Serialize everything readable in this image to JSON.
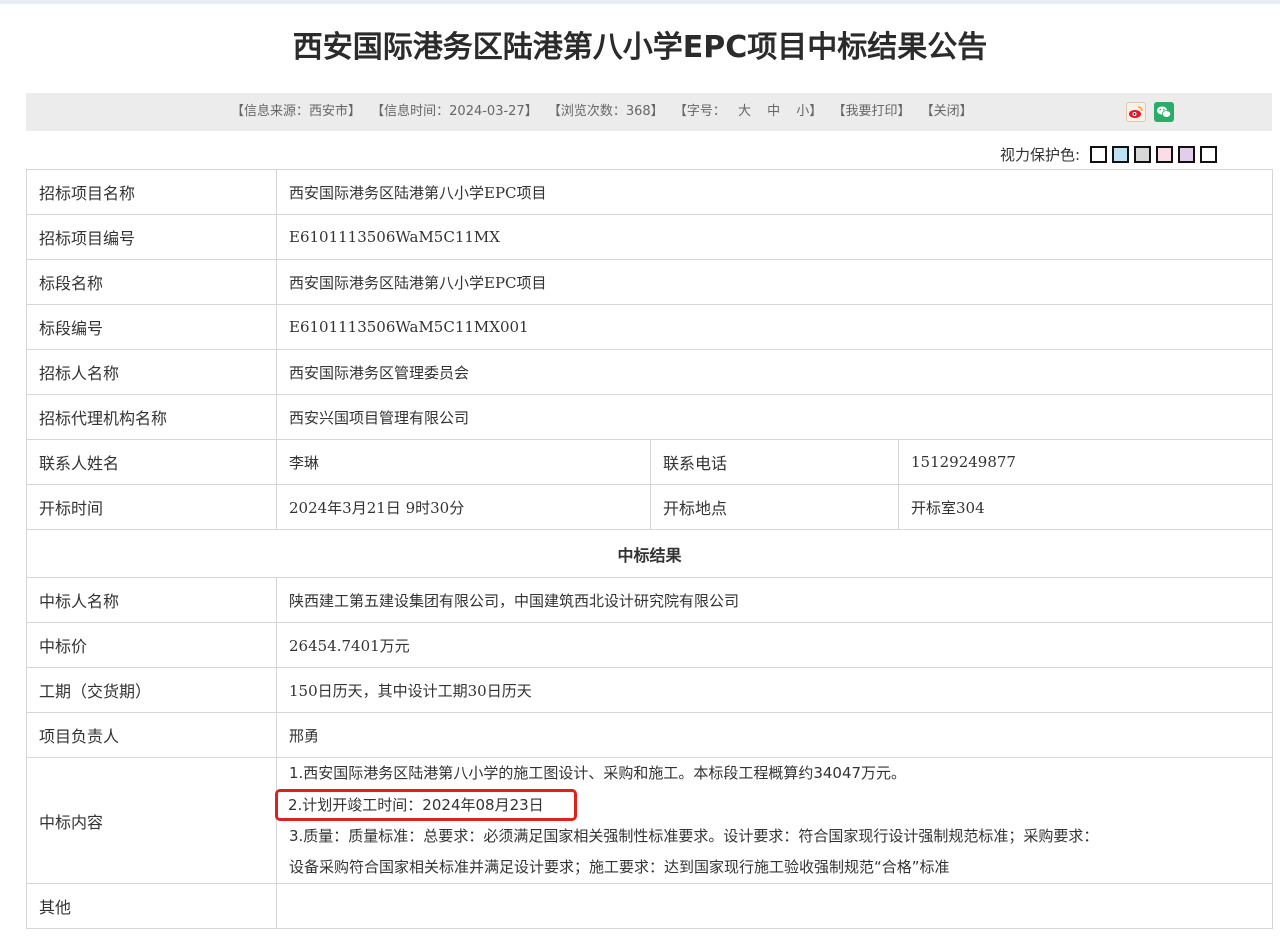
{
  "page": {
    "title": "西安国际港务区陆港第八小学EPC项目中标结果公告"
  },
  "info_bar": {
    "source": "【信息来源：西安市】",
    "time": "【信息时间：2024-03-27】",
    "views": "【浏览次数：368】",
    "font_size_label": "【字号：",
    "font_large": "大",
    "font_medium": "中",
    "font_small": "小】",
    "print": "【我要打印】",
    "close": "【关闭】"
  },
  "share": {
    "weibo_icon": "weibo-icon",
    "wechat_icon": "wechat-icon"
  },
  "eye_protection": {
    "label": "视力保护色:",
    "swatches": [
      "#ffffff",
      "#bde2f3",
      "#d8d8d8",
      "#fadde7",
      "#e3cdef",
      "#ffffff"
    ]
  },
  "table": {
    "rows": [
      {
        "label": "招标项目名称",
        "value": "西安国际港务区陆港第八小学EPC项目"
      },
      {
        "label": "招标项目编号",
        "value": "E6101113506WaM5C11MX"
      },
      {
        "label": "标段名称",
        "value": "西安国际港务区陆港第八小学EPC项目"
      },
      {
        "label": "标段编号",
        "value": "E6101113506WaM5C11MX001"
      },
      {
        "label": "招标人名称",
        "value": "西安国际港务区管理委员会"
      },
      {
        "label": "招标代理机构名称",
        "value": "西安兴国项目管理有限公司"
      }
    ],
    "contact": {
      "label": "联系人姓名",
      "value": "李琳",
      "phone_label": "联系电话",
      "phone_value": "15129249877"
    },
    "opening": {
      "label": "开标时间",
      "value": "2024年3月21日 9时30分",
      "place_label": "开标地点",
      "place_value": "开标室304"
    },
    "section_title": "中标结果",
    "winner": {
      "label": "中标人名称",
      "value": "陕西建工第五建设集团有限公司，中国建筑西北设计研究院有限公司"
    },
    "price": {
      "label": "中标价",
      "value": "26454.7401万元"
    },
    "period": {
      "label": "工期（交货期）",
      "value": "150日历天，其中设计工期30日历天"
    },
    "manager": {
      "label": "项目负责人",
      "value": "邢勇"
    },
    "content": {
      "label": "中标内容",
      "line1": "1.西安国际港务区陆港第八小学的施工图设计、采购和施工。本标段工程概算约34047万元。",
      "line2": "2.计划开竣工时间：2024年08月23日",
      "line3": "3.质量：质量标准：总要求：必须满足国家相关强制性标准要求。设计要求：符合国家现行设计强制规范标准；采购要求：",
      "line4": "设备采购符合国家相关标准并满足设计要求；施工要求：达到国家现行施工验收强制规范“合格”标准"
    },
    "other": {
      "label": "其他",
      "value": ""
    }
  }
}
